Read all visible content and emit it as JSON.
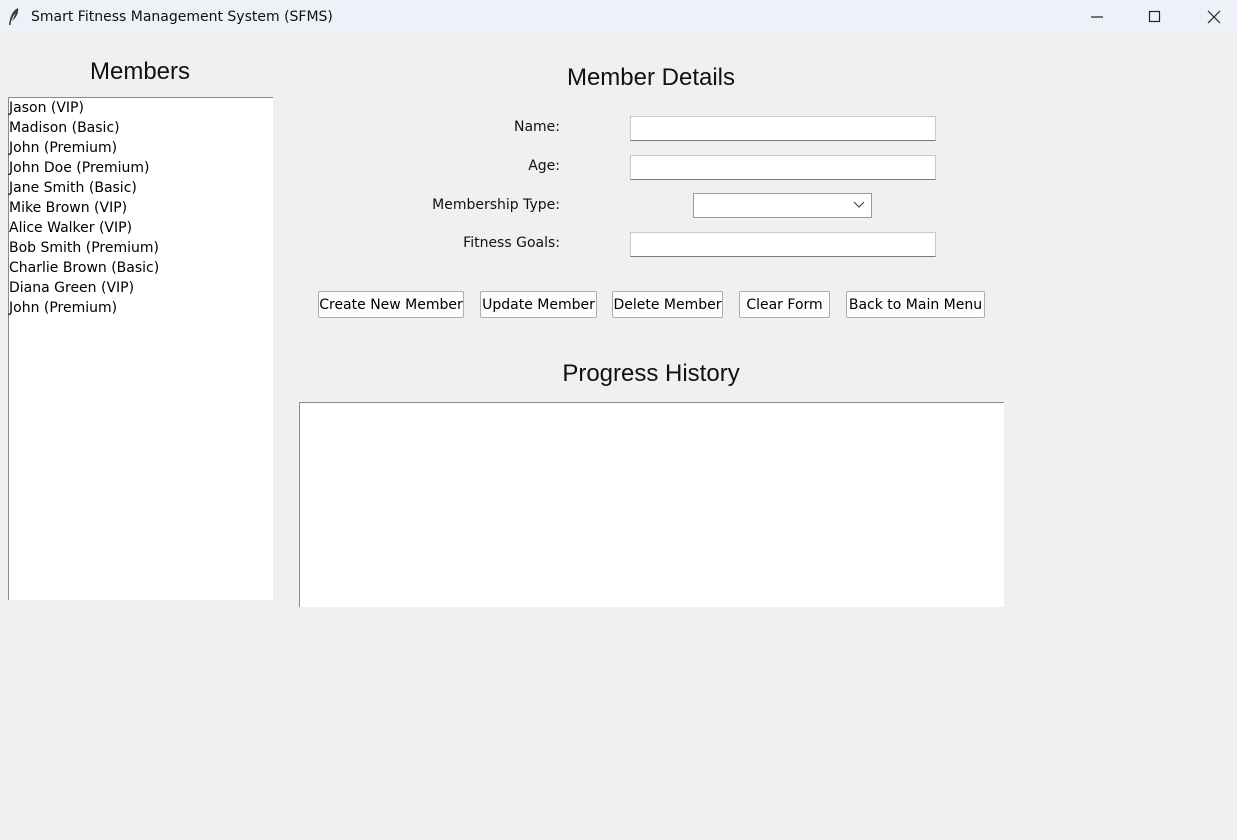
{
  "window": {
    "title": "Smart Fitness Management System (SFMS)"
  },
  "members_panel": {
    "title": "Members",
    "items": [
      "Jason (VIP)",
      "Madison (Basic)",
      "John (Premium)",
      "John Doe (Premium)",
      "Jane Smith (Basic)",
      "Mike Brown (VIP)",
      "Alice Walker (VIP)",
      "Bob Smith (Premium)",
      "Charlie Brown (Basic)",
      "Diana Green (VIP)",
      "John (Premium)"
    ]
  },
  "details": {
    "title": "Member Details",
    "name_label": "Name:",
    "name_value": "",
    "age_label": "Age:",
    "age_value": "",
    "membership_label": "Membership Type:",
    "membership_value": "",
    "goals_label": "Fitness Goals:",
    "goals_value": ""
  },
  "buttons": {
    "create": "Create New Member",
    "update": "Update Member",
    "delete": "Delete Member",
    "clear": "Clear Form",
    "back": "Back to Main Menu"
  },
  "progress": {
    "title": "Progress History",
    "content": ""
  },
  "icons": {
    "app": "feather-icon",
    "minimize": "minimize-icon",
    "maximize": "maximize-icon",
    "close": "close-icon"
  }
}
